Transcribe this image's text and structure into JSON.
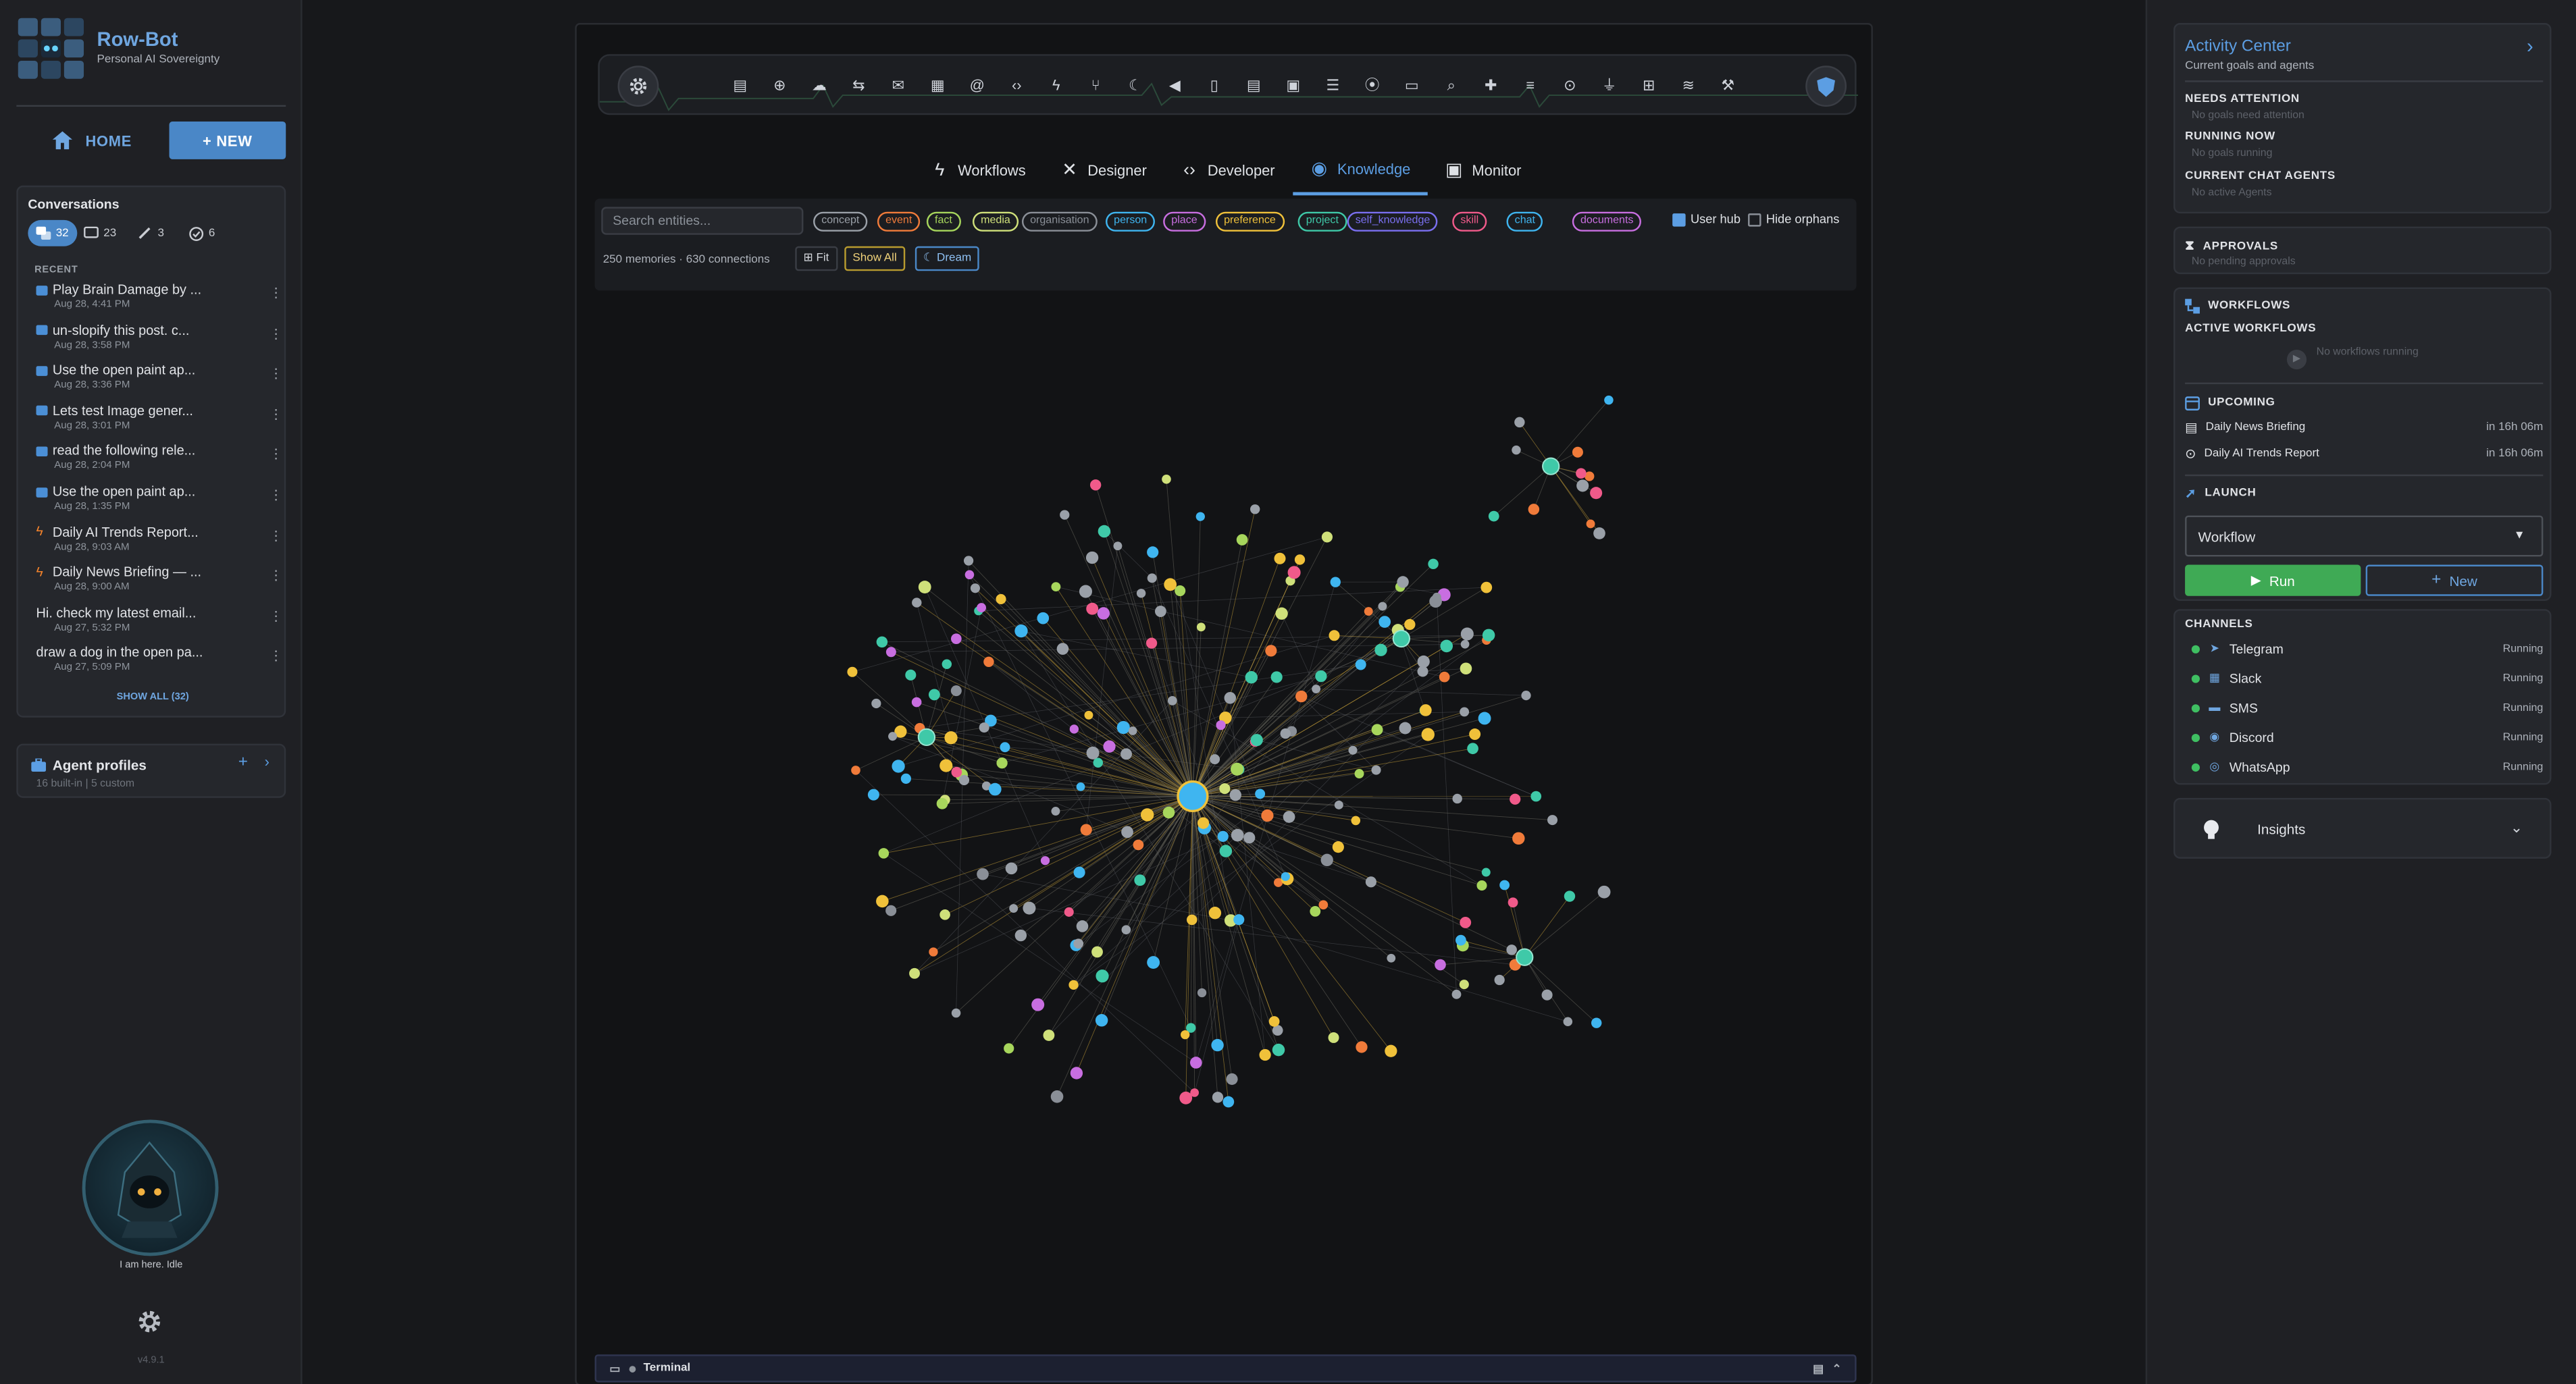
{
  "brand": {
    "name": "Row-Bot",
    "tagline": "Personal AI Sovereignty",
    "version": "v4.9.1"
  },
  "nav": {
    "home_label": "HOME",
    "new_label": "+ NEW"
  },
  "conversations": {
    "title": "Conversations",
    "filters": [
      {
        "icon": "chat-bubbles-icon",
        "count": "32"
      },
      {
        "icon": "chat-icon",
        "count": "23"
      },
      {
        "icon": "brush-icon",
        "count": "3"
      },
      {
        "icon": "check-circle-icon",
        "count": "6"
      }
    ],
    "recent_label": "RECENT",
    "items": [
      {
        "title": "Play Brain Damage by ...",
        "date": "Aug 28, 4:41 PM",
        "icon": "chat-icon"
      },
      {
        "title": "un-slopify this post. c...",
        "date": "Aug 28, 3:58 PM",
        "icon": "chat-icon"
      },
      {
        "title": "Use the open paint ap...",
        "date": "Aug 28, 3:36 PM",
        "icon": "chat-icon"
      },
      {
        "title": "Lets test Image gener...",
        "date": "Aug 28, 3:01 PM",
        "icon": "chat-icon"
      },
      {
        "title": "read the following rele...",
        "date": "Aug 28, 2:04 PM",
        "icon": "chat-icon"
      },
      {
        "title": "Use the open paint ap...",
        "date": "Aug 28, 1:35 PM",
        "icon": "chat-icon"
      },
      {
        "title": "Daily AI Trends Report...",
        "date": "Aug 28, 9:03 AM",
        "icon": "bolt-icon"
      },
      {
        "title": "Daily News Briefing — ...",
        "date": "Aug 28, 9:00 AM",
        "icon": "bolt-icon"
      },
      {
        "title": "Hi. check my latest email...",
        "date": "Aug 27, 5:32 PM",
        "icon": "none"
      },
      {
        "title": "draw a dog in the open pa...",
        "date": "Aug 27, 5:09 PM",
        "icon": "none"
      }
    ],
    "show_all": "SHOW ALL (32)"
  },
  "agent_profiles": {
    "title": "Agent profiles",
    "sub": "16 built-in | 5 custom"
  },
  "assistant": {
    "status": "I am here. Idle"
  },
  "toolbar": {
    "icons": [
      "server-icon",
      "globe-icon",
      "cloud-icon",
      "link-icon",
      "mail-icon",
      "calendar-icon",
      "at-icon",
      "code-icon",
      "bolt-icon",
      "branch-icon",
      "moon-icon",
      "speaker-icon",
      "file-icon",
      "document-icon",
      "save-icon",
      "list-icon",
      "node-icon",
      "folder-icon",
      "search-icon",
      "puzzle-icon",
      "filter-list-icon",
      "robot-icon",
      "plug-icon",
      "grid-icon",
      "wifi-icon",
      "wrench-icon"
    ]
  },
  "tabs": [
    {
      "label": "Workflows",
      "icon": "bolt-icon"
    },
    {
      "label": "Designer",
      "icon": "tools-icon"
    },
    {
      "label": "Developer",
      "icon": "code-icon"
    },
    {
      "label": "Knowledge",
      "icon": "lightbulb-icon"
    },
    {
      "label": "Monitor",
      "icon": "monitor-icon"
    }
  ],
  "knowledge": {
    "search_placeholder": "Search entities...",
    "entity_types": [
      {
        "label": "concept",
        "color": "#9aa0a8"
      },
      {
        "label": "event",
        "color": "#f07b3a"
      },
      {
        "label": "fact",
        "color": "#a7d65c"
      },
      {
        "label": "media",
        "color": "#cfe07a"
      },
      {
        "label": "organisation",
        "color": "#8a8f97"
      },
      {
        "label": "person",
        "color": "#3fb5f0"
      },
      {
        "label": "place",
        "color": "#c86ee0"
      },
      {
        "label": "preference",
        "color": "#f0c13a"
      },
      {
        "label": "project",
        "color": "#3fc9a8"
      },
      {
        "label": "self_knowledge",
        "color": "#7a6ff0"
      },
      {
        "label": "skill",
        "color": "#f05a8a"
      }
    ],
    "sources": [
      {
        "label": "chat",
        "color": "#3fb5f0"
      },
      {
        "label": "documents",
        "color": "#c86ee0"
      }
    ],
    "user_hub": {
      "label": "User hub",
      "checked": true
    },
    "hide_orphans": {
      "label": "Hide orphans",
      "checked": false
    },
    "stats": "250 memories · 630 connections",
    "fit_label": "Fit",
    "show_all_label": "Show All",
    "dream_label": "Dream"
  },
  "terminal": {
    "label": "Terminal"
  },
  "activity": {
    "title": "Activity Center",
    "sub": "Current goals and agents",
    "needs_attention": {
      "label": "NEEDS ATTENTION",
      "empty": "No goals need attention"
    },
    "running_now": {
      "label": "RUNNING NOW",
      "empty": "No goals running"
    },
    "chat_agents": {
      "label": "CURRENT CHAT AGENTS",
      "empty": "No active Agents"
    }
  },
  "approvals": {
    "label": "APPROVALS",
    "empty": "No pending approvals"
  },
  "workflows": {
    "label": "WORKFLOWS",
    "active_label": "ACTIVE WORKFLOWS",
    "active_empty": "No workflows running",
    "upcoming_label": "UPCOMING",
    "upcoming": [
      {
        "name": "Daily News Briefing",
        "when": "in 16h 06m",
        "icon": "newspaper-icon"
      },
      {
        "name": "Daily AI Trends Report",
        "when": "in 16h 06m",
        "icon": "robot-icon"
      }
    ],
    "launch_label": "LAUNCH",
    "launch_select": "Workflow",
    "run_label": "Run",
    "new_label": "New"
  },
  "channels": {
    "label": "CHANNELS",
    "items": [
      {
        "name": "Telegram",
        "status": "Running",
        "icon": "telegram-icon"
      },
      {
        "name": "Slack",
        "status": "Running",
        "icon": "slack-icon"
      },
      {
        "name": "SMS",
        "status": "Running",
        "icon": "sms-icon"
      },
      {
        "name": "Discord",
        "status": "Running",
        "icon": "discord-icon"
      },
      {
        "name": "WhatsApp",
        "status": "Running",
        "icon": "whatsapp-icon"
      }
    ]
  },
  "insights": {
    "label": "Insights"
  }
}
